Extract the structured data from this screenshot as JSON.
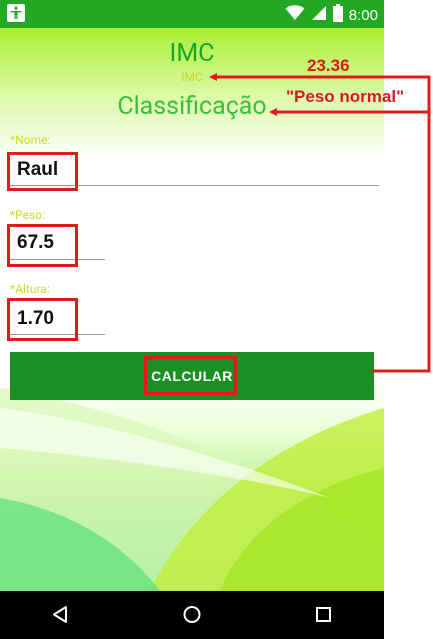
{
  "status_bar": {
    "time": "8:00",
    "left_icon": "accessibility-icon",
    "icons": [
      "wifi-icon",
      "signal-icon",
      "battery-icon"
    ]
  },
  "header": {
    "title": "IMC",
    "imc_value_label": "IMC",
    "classification_label": "Classificação"
  },
  "form": {
    "name": {
      "label": "*Nome:",
      "value": "Raul"
    },
    "weight": {
      "label": "*Peso:",
      "value": "67.5"
    },
    "height": {
      "label": "*Altura:",
      "value": "1.70"
    },
    "calculate_label": "CALCULAR"
  },
  "annotations": {
    "imc_result": "23.36",
    "classification_result": "\"Peso normal\"",
    "color": "#e11b1b"
  },
  "nav_bar": {
    "buttons": [
      "back-icon",
      "home-icon",
      "recents-icon"
    ]
  },
  "colors": {
    "status_bar": "#22a822",
    "button": "#1a8f22",
    "title_green": "#18a828",
    "label_yellow_green": "#c8dc2a"
  }
}
